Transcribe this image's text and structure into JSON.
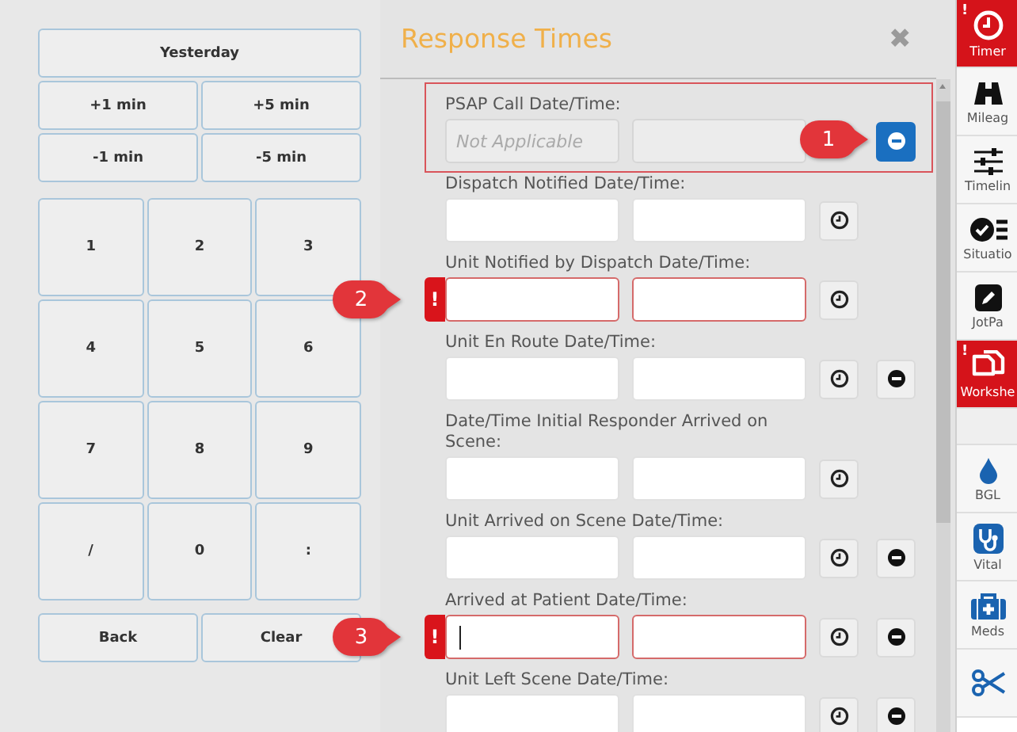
{
  "keypad_panel": {
    "quick_buttons": [
      [
        "Yesterday"
      ],
      [
        "+1 min",
        "+5 min"
      ],
      [
        "-1 min",
        "-5 min"
      ]
    ],
    "keys": [
      "1",
      "2",
      "3",
      "4",
      "5",
      "6",
      "7",
      "8",
      "9",
      "/",
      "0",
      ":"
    ],
    "bottom_buttons": [
      "Back",
      "Clear"
    ]
  },
  "dialog": {
    "title": "Response Times",
    "close": "✖",
    "rows": [
      {
        "label": "PSAP Call Date/Time:",
        "disabled": true,
        "placeholder": "Not Applicable",
        "error": false,
        "focused": false,
        "clock": false,
        "minus": true,
        "minus_active": true,
        "highlighted": true,
        "callout": "1"
      },
      {
        "label": "Dispatch Notified Date/Time:",
        "disabled": false,
        "error": false,
        "focused": false,
        "clock": true,
        "minus": false,
        "minus_active": false,
        "highlighted": false
      },
      {
        "label": "Unit Notified by Dispatch Date/Time:",
        "disabled": false,
        "error": true,
        "badge": "!",
        "focused": false,
        "clock": true,
        "minus": false,
        "minus_active": false,
        "highlighted": false,
        "callout": "2"
      },
      {
        "label": "Unit En Route Date/Time:",
        "disabled": false,
        "error": false,
        "focused": false,
        "clock": true,
        "minus": true,
        "minus_active": false,
        "highlighted": false
      },
      {
        "label": "Date/Time Initial Responder Arrived on Scene:",
        "disabled": false,
        "error": false,
        "focused": false,
        "clock": true,
        "minus": false,
        "minus_active": false,
        "highlighted": false
      },
      {
        "label": "Unit Arrived on Scene Date/Time:",
        "disabled": false,
        "error": false,
        "focused": false,
        "clock": true,
        "minus": true,
        "minus_active": false,
        "highlighted": false
      },
      {
        "label": "Arrived at Patient Date/Time:",
        "disabled": false,
        "error": true,
        "badge": "!",
        "focused": true,
        "clock": true,
        "minus": true,
        "minus_active": false,
        "highlighted": false,
        "callout": "3"
      },
      {
        "label": "Unit Left Scene Date/Time:",
        "disabled": false,
        "error": false,
        "focused": false,
        "clock": true,
        "minus": true,
        "minus_active": false,
        "highlighted": false
      }
    ]
  },
  "sidebar": {
    "items": [
      {
        "kind": "clock",
        "label": "Timer",
        "alert": true,
        "badge": "!"
      },
      {
        "kind": "binoculars",
        "label": "Mileag",
        "alert": false
      },
      {
        "kind": "sliders",
        "label": "Timelin",
        "alert": false
      },
      {
        "kind": "checklist",
        "label": "Situatio",
        "alert": false
      },
      {
        "kind": "pencil",
        "label": "JotPa",
        "alert": false
      },
      {
        "kind": "pages",
        "label": "Workshe",
        "alert": true,
        "badge": "!"
      },
      {
        "kind": "spacer"
      },
      {
        "kind": "drop",
        "label": "BGL",
        "alert": false
      },
      {
        "kind": "stethoscope",
        "label": "Vital",
        "alert": false
      },
      {
        "kind": "medkit",
        "label": "Meds",
        "alert": false
      },
      {
        "kind": "scissors",
        "alert": false
      }
    ]
  }
}
